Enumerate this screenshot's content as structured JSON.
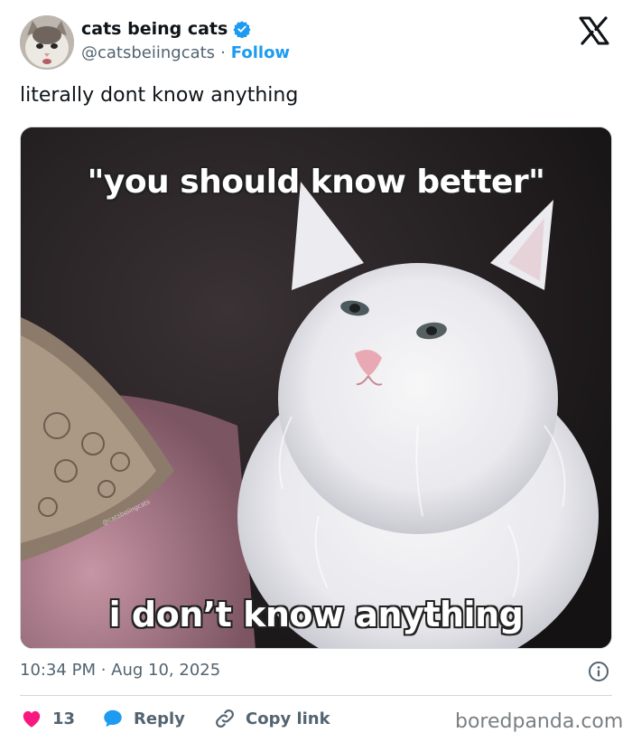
{
  "author": {
    "display_name": "cats being cats",
    "handle": "@catsbeiingcats",
    "separator": "·",
    "follow_label": "Follow",
    "verified": true
  },
  "tweet": {
    "text": "literally dont know anything",
    "timestamp": "10:34 PM · Aug 10, 2025"
  },
  "media": {
    "caption_top": "\"you should know better\"",
    "caption_bottom": "i don’t know anything",
    "watermark": "@catsbeiingcats"
  },
  "actions": {
    "like_count": "13",
    "reply_label": "Reply",
    "copy_link_label": "Copy link"
  },
  "branding": {
    "site": "boredpanda.com"
  },
  "colors": {
    "accent": "#1d9bf0",
    "like": "#f91880",
    "text": "#0f1419",
    "muted": "#536471"
  },
  "icons": [
    "verified-badge-icon",
    "x-logo-icon",
    "info-icon",
    "heart-icon",
    "reply-bubble-icon",
    "link-icon"
  ]
}
